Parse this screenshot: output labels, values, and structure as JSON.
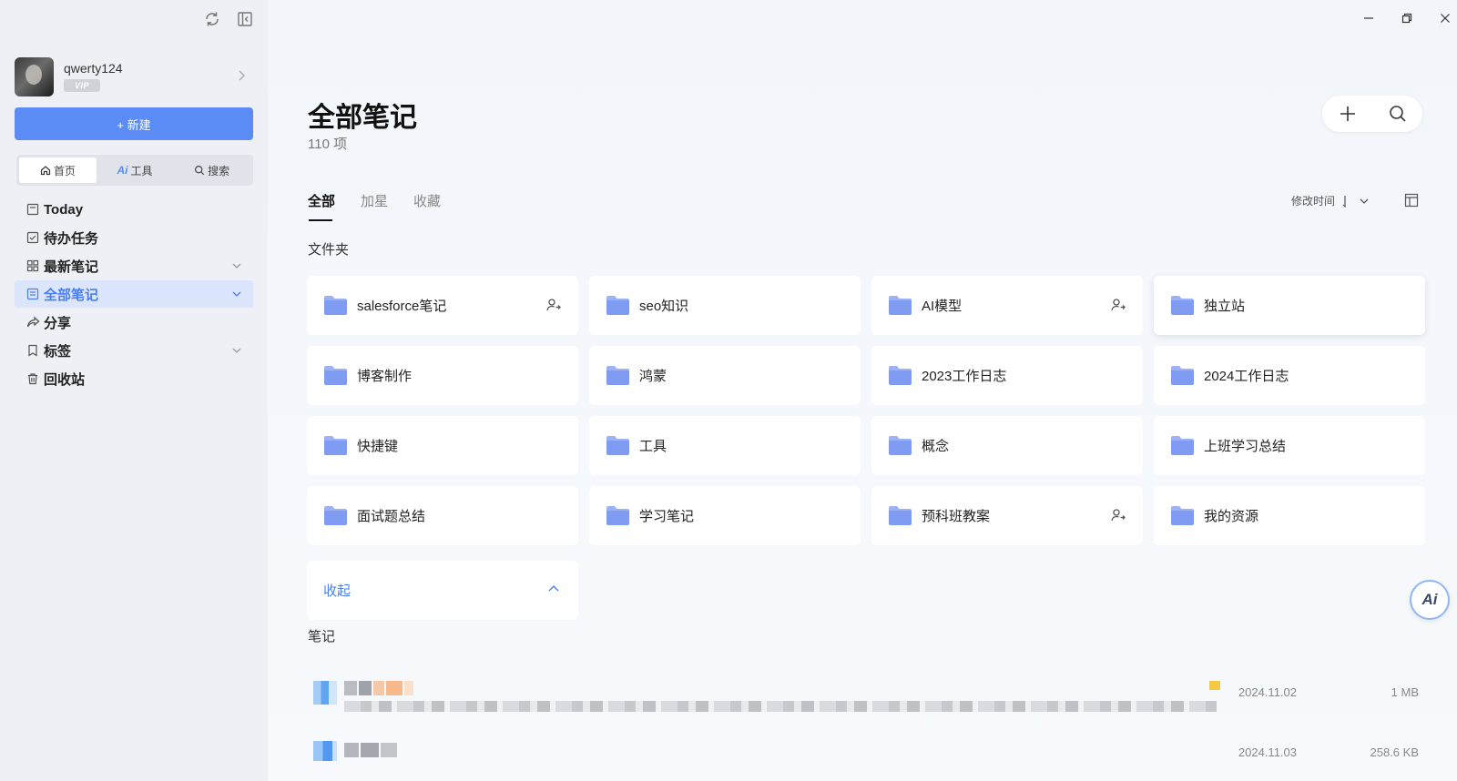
{
  "app": {
    "title": "全部笔记"
  },
  "user": {
    "name": "qwerty124",
    "badge": "VIP"
  },
  "sidebar": {
    "new_label": "+ 新建",
    "segments": [
      {
        "label": "首页",
        "icon": "home-icon"
      },
      {
        "label": "工具",
        "icon": "ai-icon"
      },
      {
        "label": "搜索",
        "icon": "search-icon"
      }
    ],
    "items": [
      {
        "label": "Today",
        "icon": "calendar-icon"
      },
      {
        "label": "待办任务",
        "icon": "checkbox-icon"
      },
      {
        "label": "最新笔记",
        "icon": "grid-icon"
      },
      {
        "label": "全部笔记",
        "icon": "note-icon"
      },
      {
        "label": "分享",
        "icon": "share-icon"
      },
      {
        "label": "标签",
        "icon": "bookmark-icon"
      },
      {
        "label": "回收站",
        "icon": "trash-icon"
      }
    ]
  },
  "main": {
    "title": "全部笔记",
    "count": "110 项",
    "tabs": [
      "全部",
      "加星",
      "收藏"
    ],
    "sort_label": "修改时间",
    "folders_label": "文件夹",
    "folders": [
      {
        "name": "salesforce笔记",
        "shared": true
      },
      {
        "name": "seo知识",
        "shared": false
      },
      {
        "name": "AI模型",
        "shared": true
      },
      {
        "name": "独立站",
        "shared": false
      },
      {
        "name": "博客制作",
        "shared": false
      },
      {
        "name": "鸿蒙",
        "shared": false
      },
      {
        "name": "2023工作日志",
        "shared": false
      },
      {
        "name": "2024工作日志",
        "shared": false
      },
      {
        "name": "快捷键",
        "shared": false
      },
      {
        "name": "工具",
        "shared": false
      },
      {
        "name": "概念",
        "shared": false
      },
      {
        "name": "上班学习总结",
        "shared": false
      },
      {
        "name": "面试题总结",
        "shared": false
      },
      {
        "name": "学习笔记",
        "shared": false
      },
      {
        "name": "预科班教案",
        "shared": true
      },
      {
        "name": "我的资源",
        "shared": false
      }
    ],
    "collapse_label": "收起",
    "notes_label": "笔记",
    "notes": [
      {
        "date": "2024.11.02",
        "size": "1 MB"
      },
      {
        "date": "2024.11.03",
        "size": "258.6 KB"
      }
    ],
    "ai_button": "Ai"
  },
  "colors": {
    "accent": "#5b8cf5",
    "folder": "#7f9cf2"
  }
}
